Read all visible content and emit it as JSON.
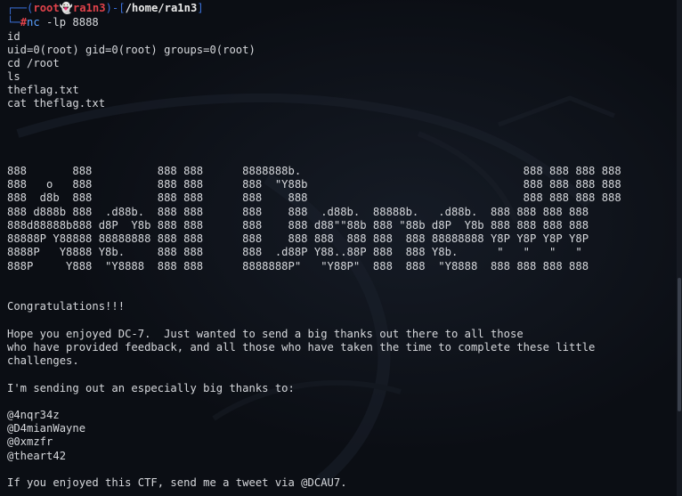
{
  "terminal": {
    "prompt": {
      "top_bracket": "┌──(",
      "user_host": "root👻ra1n3",
      "mid_bracket": ")-[",
      "path": "/home/ra1n3",
      "end_bracket": "]",
      "bottom_bracket": "└─",
      "symbol": "#",
      "command": "nc",
      "args": " -lp 8888"
    },
    "session_lines": [
      "id",
      "uid=0(root) gid=0(root) groups=0(root)",
      "cd /root",
      "ls",
      "theflag.txt",
      "cat theflag.txt"
    ],
    "ascii_art": [
      "888       888          888 888      8888888b.                                  888 888 888 888",
      "888   o   888          888 888      888  \"Y88b                                 888 888 888 888",
      "888  d8b  888          888 888      888    888                                 888 888 888 888",
      "888 d888b 888  .d88b.  888 888      888    888  .d88b.  88888b.   .d88b.  888 888 888 888",
      "888d88888b888 d8P  Y8b 888 888      888    888 d88\"\"88b 888 \"88b d8P  Y8b 888 888 888 888",
      "88888P Y88888 88888888 888 888      888    888 888  888 888  888 88888888 Y8P Y8P Y8P Y8P",
      "8888P   Y8888 Y8b.     888 888      888  .d88P Y88..88P 888  888 Y8b.      \"   \"   \"   \"",
      "888P     Y888  \"Y8888  888 888      8888888P\"   \"Y88P\"  888  888  \"Y8888  888 888 888 888"
    ],
    "message_lines": [
      "Congratulations!!!",
      "Hope you enjoyed DC-7.  Just wanted to send a big thanks out there to all those",
      "who have provided feedback, and all those who have taken the time to complete these little",
      "challenges.",
      "I'm sending out an especially big thanks to:",
      "@4nqr34z",
      "@D4mianWayne",
      "@0xmzfr",
      "@theart42",
      "If you enjoyed this CTF, send me a tweet via @DCAU7."
    ]
  },
  "colors": {
    "background": "#0b0e14",
    "text": "#d6d8dc",
    "prompt_bracket": "#3a6fd8",
    "prompt_user": "#e0424a",
    "command": "#5aa0ff"
  }
}
